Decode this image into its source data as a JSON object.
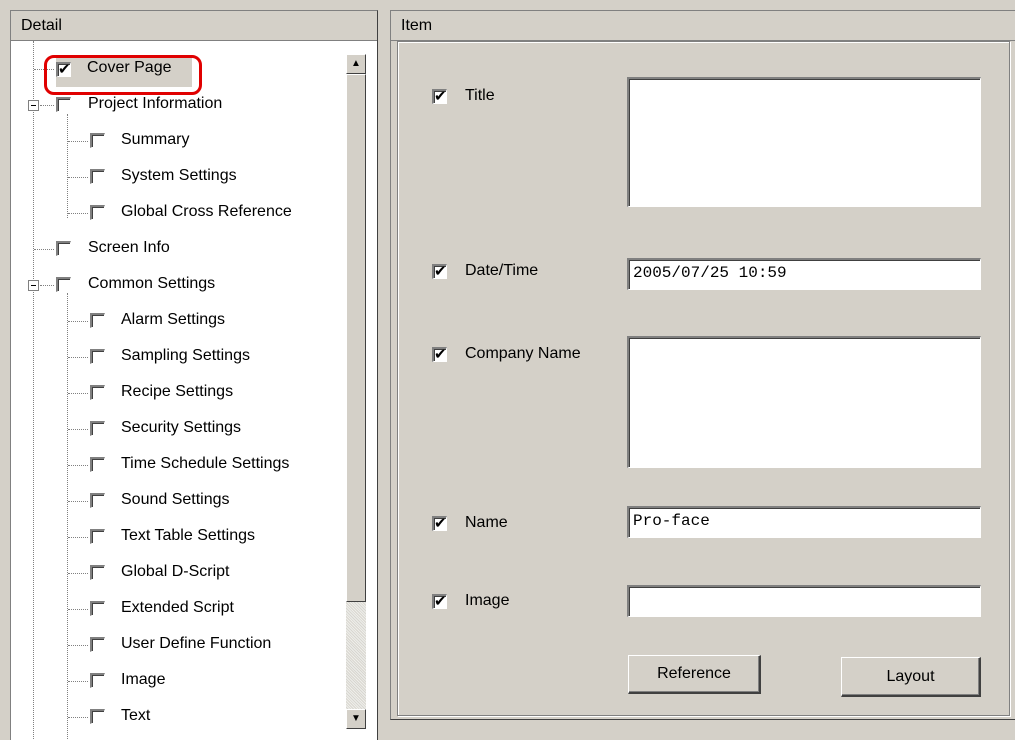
{
  "detail_panel": {
    "header": "Detail",
    "tree": [
      {
        "label": "Cover Page",
        "checked": true
      },
      {
        "label": "Project Information",
        "checked": false
      },
      {
        "label": "Summary",
        "checked": false
      },
      {
        "label": "System Settings",
        "checked": false
      },
      {
        "label": "Global Cross Reference",
        "checked": false
      },
      {
        "label": "Screen Info",
        "checked": false
      },
      {
        "label": "Common Settings",
        "checked": false
      },
      {
        "label": "Alarm Settings",
        "checked": false
      },
      {
        "label": "Sampling Settings",
        "checked": false
      },
      {
        "label": "Recipe Settings",
        "checked": false
      },
      {
        "label": "Security Settings",
        "checked": false
      },
      {
        "label": "Time Schedule Settings",
        "checked": false
      },
      {
        "label": "Sound Settings",
        "checked": false
      },
      {
        "label": "Text Table Settings",
        "checked": false
      },
      {
        "label": "Global D-Script",
        "checked": false
      },
      {
        "label": "Extended Script",
        "checked": false
      },
      {
        "label": "User Define Function",
        "checked": false
      },
      {
        "label": "Image",
        "checked": false
      },
      {
        "label": "Text",
        "checked": false
      }
    ]
  },
  "item_panel": {
    "header": "Item",
    "fields": {
      "title": {
        "label": "Title",
        "checked": true,
        "value": ""
      },
      "datetime": {
        "label": "Date/Time",
        "checked": true,
        "value": "2005/07/25 10:59"
      },
      "company": {
        "label": "Company Name",
        "checked": true,
        "value": ""
      },
      "name": {
        "label": "Name",
        "checked": true,
        "value": "Pro-face"
      },
      "image": {
        "label": "Image",
        "checked": true,
        "value": ""
      }
    },
    "buttons": {
      "reference": "Reference",
      "layout": "Layout"
    }
  },
  "colors": {
    "face": "#d4d0c8",
    "highlight": "#e00000"
  }
}
